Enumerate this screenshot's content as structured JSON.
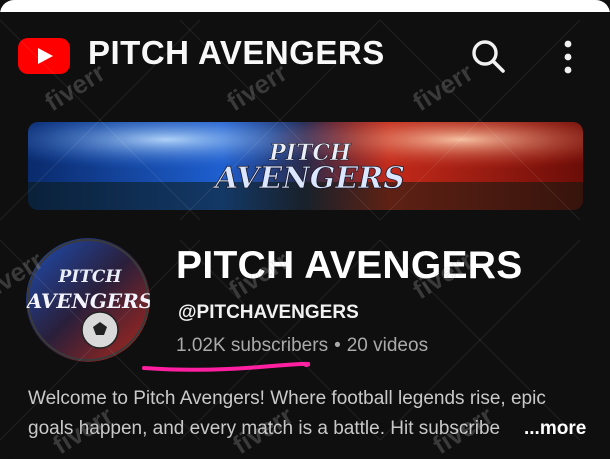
{
  "topbar": {
    "title": "PITCH AVENGERS",
    "logo_icon": "youtube-logo-icon",
    "search_icon": "search-icon",
    "more_icon": "more-vert-icon"
  },
  "banner": {
    "title_line1": "PITCH",
    "title_line2": "AVENGERS"
  },
  "avatar": {
    "line1": "PITCH",
    "line2": "AVENGERS"
  },
  "channel": {
    "name": "PITCH AVENGERS",
    "handle": "@PITCHAVENGERS",
    "subscribers": "1.02K subscribers",
    "separator": "•",
    "videos": "20 videos"
  },
  "description": {
    "line1": "Welcome to Pitch Avengers! Where football legends rise, epic",
    "line2": "goals happen, and every match is a battle. Hit subscribe",
    "more_label": "...more"
  },
  "watermark": "fiverr",
  "colors": {
    "background": "#0f0f0f",
    "brand_red": "#ff0000",
    "highlight_underline": "#ff1fa0",
    "muted_text": "#aaaaaa"
  }
}
